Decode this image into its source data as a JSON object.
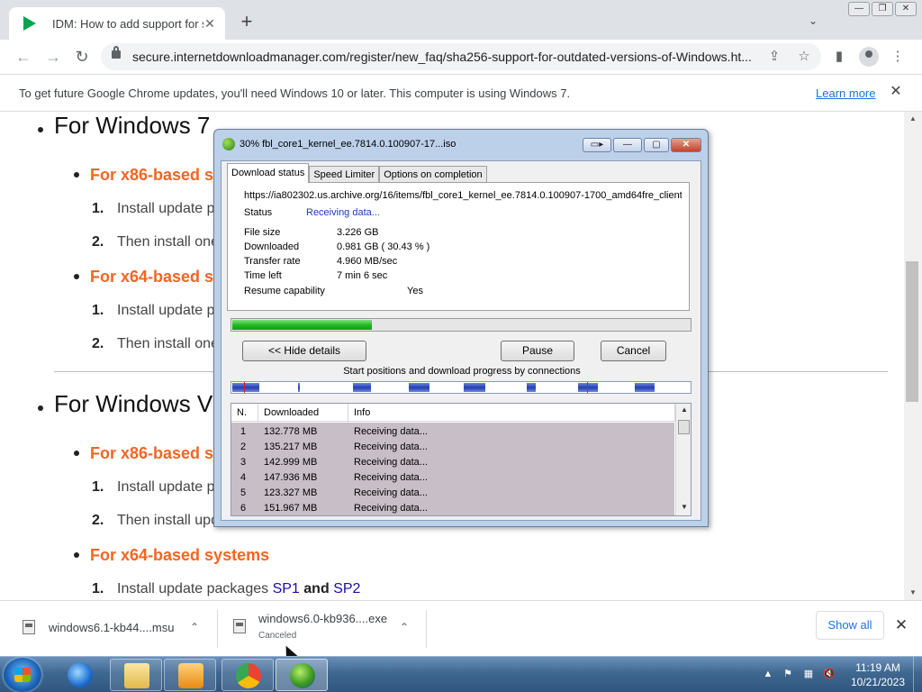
{
  "browser": {
    "tab_title": "IDM: How to add support for sha",
    "tab_close_glyph": "✕",
    "new_tab_glyph": "+",
    "tab_search_glyph": "⌄",
    "window_buttons": [
      "—",
      "❐",
      "✕"
    ],
    "back_glyph": "←",
    "forward_glyph": "→",
    "reload_glyph": "↻",
    "url": "secure.internetdownloadmanager.com/register/new_faq/sha256-support-for-outdated-versions-of-Windows.ht...",
    "share_glyph": "⇪",
    "bookmark_glyph": "☆",
    "sidepanel_glyph": "▮",
    "menu_glyph": "⋮"
  },
  "infobar": {
    "message": "To get future Google Chrome updates, you'll need Windows 10 or later. This computer is using Windows 7.",
    "link": "Learn more",
    "close_glyph": "✕"
  },
  "page": {
    "win7_heading": "For Windows 7",
    "x86_heading_1": "For x86-based s",
    "s1_1": "Install update p",
    "s1_2": "Then install one",
    "x64_heading_1": "For x64-based s",
    "s2_1": "Install update p",
    "s2_2": "Then install one",
    "vista_heading": "For Windows Vi",
    "x86_heading_2": "For x86-based s",
    "s3_1": "Install update p",
    "s3_2": "Then install upo",
    "x64_heading_2": "For x64-based systems",
    "s4_1_prefix": "Install update packages",
    "s4_1_link1": "SP1",
    "s4_1_and": "and",
    "s4_1_link2": "SP2",
    "num1": "1.",
    "num2": "2."
  },
  "idm": {
    "title": "30% fbl_core1_kernel_ee.7814.0.100907-17...iso",
    "title_buttons": [
      "▭▸",
      "—",
      "▢",
      "✕"
    ],
    "tabs": [
      "Download status",
      "Speed Limiter",
      "Options on completion"
    ],
    "url": "https://ia802302.us.archive.org/16/items/fbl_core1_kernel_ee.7814.0.100907-1700_amd64fre_client",
    "status_label": "Status",
    "status_value": "Receiving data...",
    "file_size_label": "File size",
    "file_size_value": "3.226  GB",
    "downloaded_label": "Downloaded",
    "downloaded_value": "0.981  GB  ( 30.43 % )",
    "rate_label": "Transfer rate",
    "rate_value": "4.960  MB/sec",
    "time_left_label": "Time left",
    "time_left_value": "7 min 6 sec",
    "resume_label": "Resume capability",
    "resume_value": "Yes",
    "progress_fraction": 0.3043,
    "hide_details_button": "<< Hide details",
    "pause_button": "Pause",
    "cancel_button": "Cancel",
    "connections_caption": "Start positions and download progress by connections",
    "table_headers": [
      "N.",
      "Downloaded",
      "Info"
    ],
    "connections": [
      {
        "n": "1",
        "downloaded": "132.778  MB",
        "info": "Receiving data..."
      },
      {
        "n": "2",
        "downloaded": "135.217  MB",
        "info": "Receiving data..."
      },
      {
        "n": "3",
        "downloaded": "142.999  MB",
        "info": "Receiving data..."
      },
      {
        "n": "4",
        "downloaded": "147.936  MB",
        "info": "Receiving data..."
      },
      {
        "n": "5",
        "downloaded": "123.327  MB",
        "info": "Receiving data..."
      },
      {
        "n": "6",
        "downloaded": "151.967  MB",
        "info": "Receiving data..."
      }
    ]
  },
  "shelf": {
    "item1_name": "windows6.1-kb44....msu",
    "item2_name": "windows6.0-kb936....exe",
    "item2_status": "Canceled",
    "chevron_glyph": "⌃",
    "show_all": "Show all",
    "close_glyph": "✕"
  },
  "taskbar": {
    "time": "11:19 AM",
    "date": "10/21/2023",
    "tray_glyphs": [
      "▲",
      "⚑",
      "▦",
      "🔇"
    ]
  },
  "colors": {
    "accent_orange": "#f26522",
    "link_blue": "#1a0dab",
    "idm_status_blue": "#1d3db0",
    "progress_green": "#1fb81f",
    "connection_blue": "#233fb5"
  }
}
